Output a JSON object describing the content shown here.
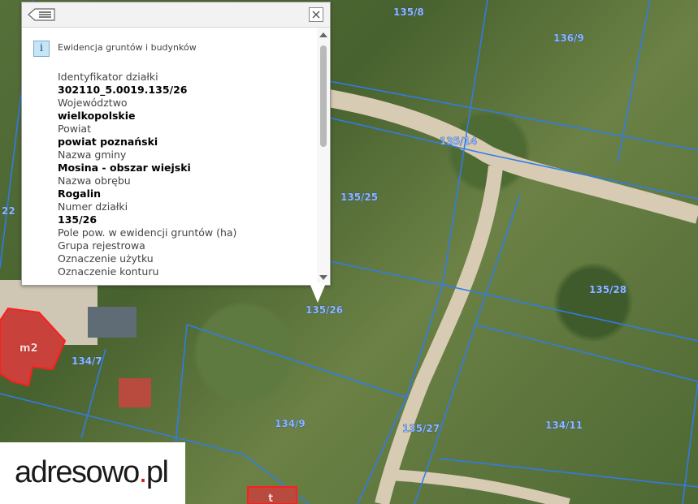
{
  "map": {
    "parcel_labels": [
      "135/8",
      "136/9",
      "135/14",
      "135/25",
      "135/28",
      "135/26",
      "134/7",
      "134/9",
      "135/27",
      "134/11",
      "22"
    ],
    "building_labels": [
      "m2",
      "t"
    ],
    "colors": {
      "parcel_line": "#2f7cf0",
      "building_outline": "#e01b1b",
      "road": "#d8cbb4"
    }
  },
  "popup": {
    "section_title": "Ewidencja gruntów i budynków",
    "attributes": [
      {
        "label": "Identyfikator działki",
        "value": "302110_5.0019.135/26"
      },
      {
        "label": "Województwo",
        "value": "wielkopolskie"
      },
      {
        "label": "Powiat",
        "value": "powiat poznański"
      },
      {
        "label": "Nazwa gminy",
        "value": "Mosina - obszar wiejski"
      },
      {
        "label": "Nazwa obrębu",
        "value": "Rogalin"
      },
      {
        "label": "Numer działki",
        "value": "135/26"
      },
      {
        "label": "Pole pow. w ewidencji gruntów (ha)",
        "value": ""
      },
      {
        "label": "Grupa rejestrowa",
        "value": ""
      },
      {
        "label": "Oznaczenie użytku",
        "value": ""
      },
      {
        "label": "Oznaczenie konturu",
        "value": ""
      }
    ],
    "icons": {
      "back": "back-list-icon",
      "close": "close-icon",
      "info": "info-icon"
    }
  },
  "logo": {
    "name": "adresowo",
    "dot": ".",
    "tld": "pl"
  }
}
